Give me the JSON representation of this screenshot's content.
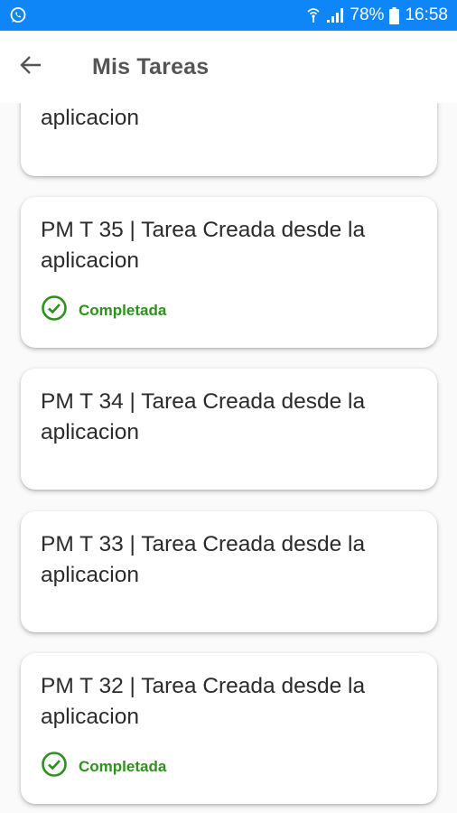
{
  "status_bar": {
    "battery": "78%",
    "time": "16:58"
  },
  "app_bar": {
    "title": "Mis Tareas"
  },
  "tasks": [
    {
      "title": "aplicacion",
      "status": ""
    },
    {
      "title": "PM T 35 | Tarea Creada desde la\naplicacion",
      "status": "Completada"
    },
    {
      "title": "PM T 34 | Tarea Creada desde la\naplicacion",
      "status": ""
    },
    {
      "title": "PM T 33 | Tarea Creada desde la\naplicacion",
      "status": ""
    },
    {
      "title": "PM T 32 | Tarea Creada desde la\naplicacion",
      "status": "Completada"
    }
  ],
  "colors": {
    "status_bar": "#0f86f7",
    "completed": "#2f8f1f"
  }
}
